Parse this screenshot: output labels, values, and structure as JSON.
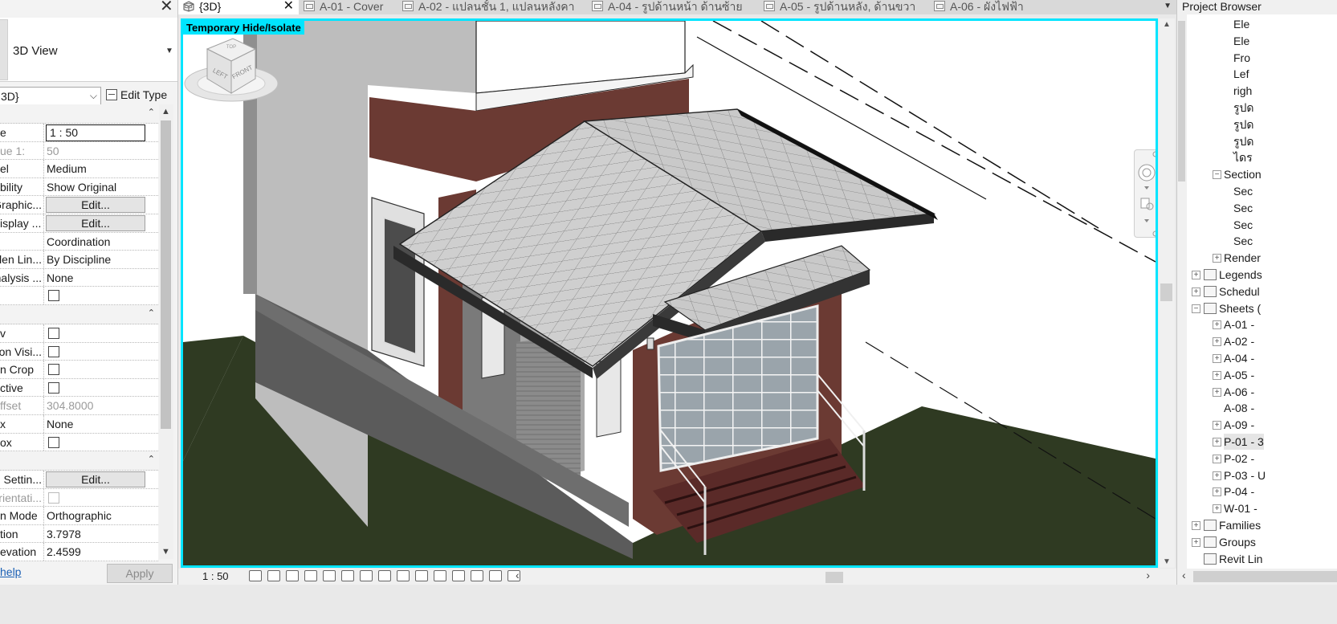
{
  "properties": {
    "type_name": "3D View",
    "type_selector": "3D}",
    "edit_type": "Edit Type",
    "rows": [
      {
        "kind": "section"
      },
      {
        "key": "e",
        "value": "1 : 50",
        "ctrl": "input"
      },
      {
        "key": "ue    1:",
        "value": "50",
        "disabled": true
      },
      {
        "key": "el",
        "value": "Medium"
      },
      {
        "key": "bility",
        "value": "Show Original"
      },
      {
        "key": "Graphic...",
        "value": "Edit...",
        "ctrl": "button"
      },
      {
        "key": "isplay ...",
        "value": "Edit...",
        "ctrl": "button"
      },
      {
        "key": "",
        "value": "Coordination"
      },
      {
        "key": "den Lin...",
        "value": "By Discipline"
      },
      {
        "key": "nalysis ...",
        "value": "None"
      },
      {
        "key": "",
        "ctrl": "checkbox"
      },
      {
        "kind": "section"
      },
      {
        "key": "v",
        "ctrl": "checkbox"
      },
      {
        "key": "on Visi...",
        "ctrl": "checkbox"
      },
      {
        "key": "n Crop",
        "ctrl": "checkbox"
      },
      {
        "key": "ctive",
        "ctrl": "checkbox"
      },
      {
        "key": "ffset",
        "value": "304.8000",
        "disabled": true
      },
      {
        "key": "x",
        "value": "None"
      },
      {
        "key": "ox",
        "ctrl": "checkbox"
      },
      {
        "kind": "section"
      },
      {
        "key": "g Settin...",
        "value": "Edit...",
        "ctrl": "button"
      },
      {
        "key": "rientati...",
        "ctrl": "checkbox",
        "disabled": true
      },
      {
        "key": "n Mode",
        "value": "Orthographic"
      },
      {
        "key": "tion",
        "value": "3.7978"
      },
      {
        "key": "evation",
        "value": "2.4599"
      }
    ],
    "help": "help",
    "apply": "Apply"
  },
  "tabs": [
    {
      "label": "{3D}",
      "active": true
    },
    {
      "label": "A-01 - Cover"
    },
    {
      "label": "A-02 - แปลนชั้น 1, แปลนหลังคา"
    },
    {
      "label": "A-04 - รูปด้านหน้า ด้านซ้าย"
    },
    {
      "label": "A-05 - รูปด้านหลัง, ด้านขวา"
    },
    {
      "label": "A-06 - ผังไฟฟ้า"
    }
  ],
  "viewport": {
    "isolate_badge": "Temporary Hide/Isolate",
    "viewcube_left": "LEFT",
    "viewcube_front": "FRONT",
    "viewcube_top": "TOP"
  },
  "viewbar": {
    "scale": "1 : 50"
  },
  "browser": {
    "title": "Project Browser",
    "items": [
      {
        "label": "Ele",
        "indent": 3
      },
      {
        "label": "Ele",
        "indent": 3
      },
      {
        "label": "Fro",
        "indent": 3
      },
      {
        "label": "Lef",
        "indent": 3
      },
      {
        "label": "righ",
        "indent": 3
      },
      {
        "label": "รูปด",
        "indent": 3
      },
      {
        "label": "รูปด",
        "indent": 3
      },
      {
        "label": "รูปด",
        "indent": 3
      },
      {
        "label": "ไดร",
        "indent": 3
      },
      {
        "label": "Section",
        "indent": 2,
        "exp": "−"
      },
      {
        "label": "Sec",
        "indent": 3
      },
      {
        "label": "Sec",
        "indent": 3
      },
      {
        "label": "Sec",
        "indent": 3
      },
      {
        "label": "Sec",
        "indent": 3
      },
      {
        "label": "Render",
        "indent": 2,
        "exp": "+"
      },
      {
        "label": "Legends",
        "indent": 1,
        "exp": "+",
        "icon": true
      },
      {
        "label": "Schedul",
        "indent": 1,
        "exp": "+",
        "icon": true
      },
      {
        "label": "Sheets (",
        "indent": 1,
        "exp": "−",
        "icon": true
      },
      {
        "label": "A-01 -",
        "indent": 2,
        "exp": "+"
      },
      {
        "label": "A-02 -",
        "indent": 2,
        "exp": "+"
      },
      {
        "label": "A-04 -",
        "indent": 2,
        "exp": "+"
      },
      {
        "label": "A-05 -",
        "indent": 2,
        "exp": "+"
      },
      {
        "label": "A-06 -",
        "indent": 2,
        "exp": "+"
      },
      {
        "label": "A-08 -",
        "indent": 2
      },
      {
        "label": "A-09 -",
        "indent": 2,
        "exp": "+"
      },
      {
        "label": "P-01 - 3",
        "indent": 2,
        "exp": "+",
        "sel": true
      },
      {
        "label": "P-02 -",
        "indent": 2,
        "exp": "+"
      },
      {
        "label": "P-03 - U",
        "indent": 2,
        "exp": "+"
      },
      {
        "label": "P-04 -",
        "indent": 2,
        "exp": "+"
      },
      {
        "label": "W-01 -",
        "indent": 2,
        "exp": "+"
      },
      {
        "label": "Families",
        "indent": 1,
        "exp": "+",
        "icon": true
      },
      {
        "label": "Groups",
        "indent": 1,
        "exp": "+",
        "icon": true
      },
      {
        "label": "Revit Lin",
        "indent": 1,
        "icon": true
      }
    ]
  },
  "colors": {
    "viewport_border": "#00e5ff",
    "wall_brown": "#6b3a33",
    "ground": "#2f3a22",
    "roof": "#c8c8c8"
  }
}
